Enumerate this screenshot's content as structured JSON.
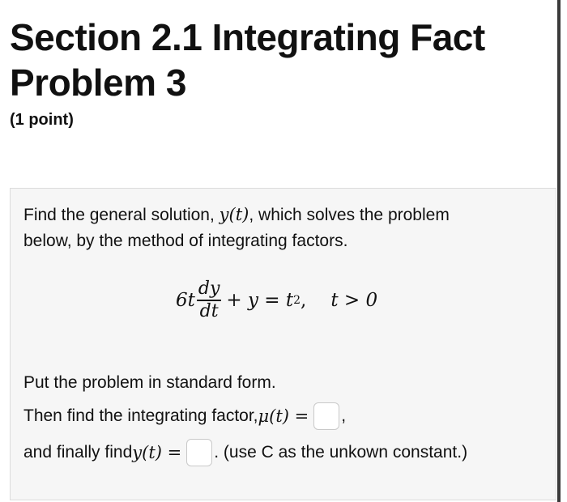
{
  "header": {
    "title_line1": "Section 2.1 Integrating Fact",
    "title_line2": "Problem 3",
    "points": "(1 point)"
  },
  "problem": {
    "intro_part1": "Find the general solution, ",
    "intro_math": "y(t)",
    "intro_part2": ", which solves the problem",
    "intro_line2": "below, by the method of integrating factors.",
    "equation": {
      "coef": "6t",
      "numerator": "dy",
      "denominator": "dt",
      "rest": "+ y = t",
      "exponent": "2",
      "comma": ",",
      "condition": "t > 0"
    },
    "standard_form": "Put the problem in standard form.",
    "factor_prefix": "Then find the integrating factor, ",
    "factor_math": "μ(t) =",
    "factor_suffix": ",",
    "final_prefix": "and finally find ",
    "final_math": "y(t) =",
    "final_suffix": ". (use C as the unkown constant.)"
  }
}
